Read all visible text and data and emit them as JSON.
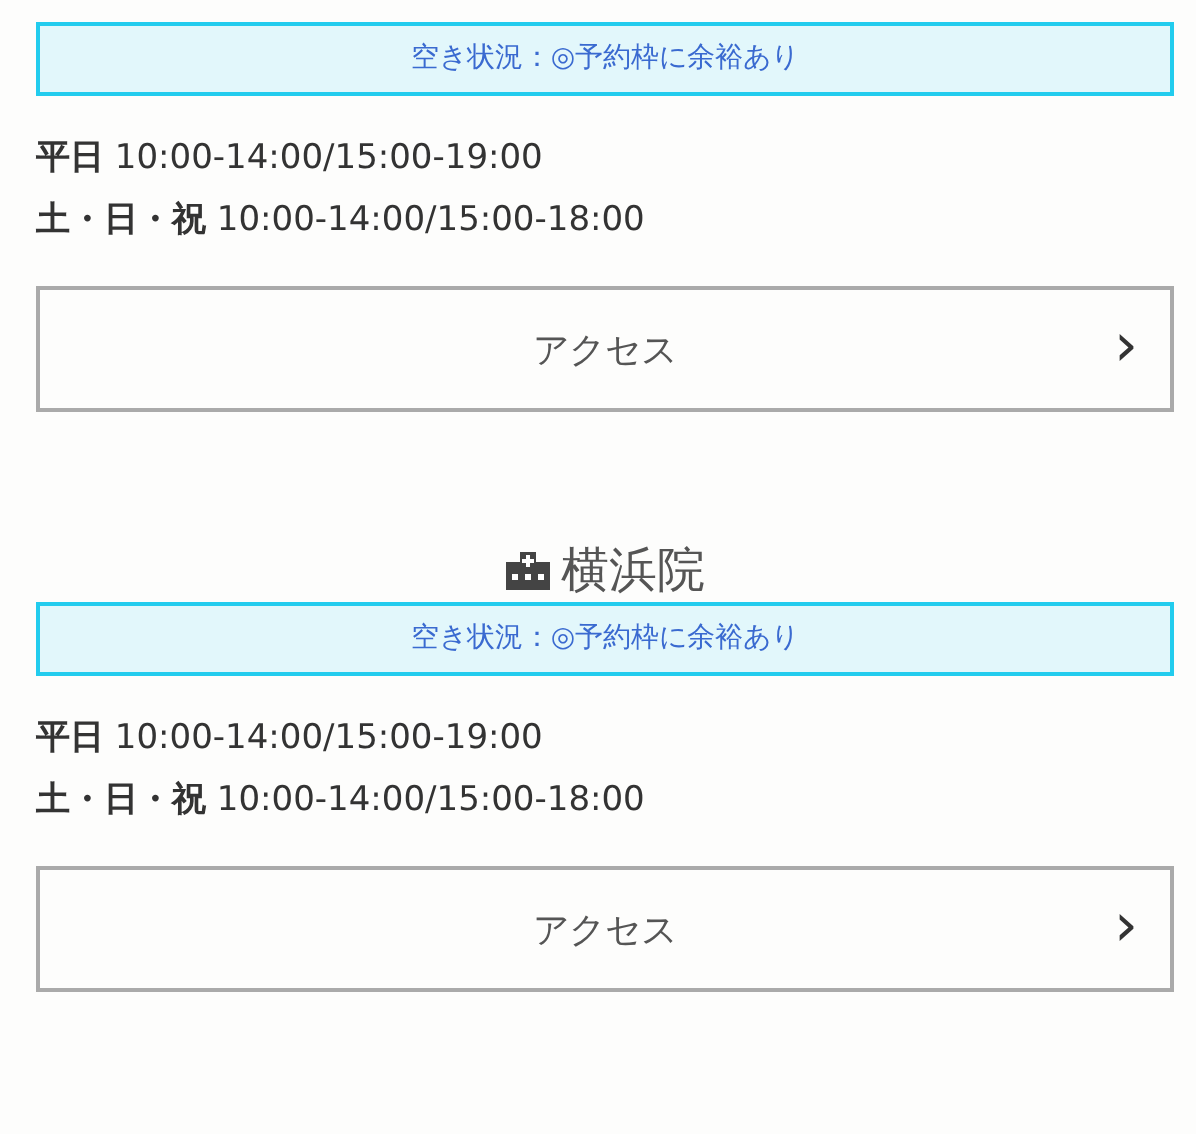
{
  "clinics": [
    {
      "status": "空き状況：◎予約枠に余裕あり",
      "hours": [
        {
          "day": "平日",
          "time": "10:00-14:00/15:00-19:00"
        },
        {
          "day": "土・日・祝",
          "time": "10:00-14:00/15:00-18:00"
        }
      ],
      "button": {
        "label": "アクセス",
        "chevron": "›"
      }
    },
    {
      "name": "横浜院",
      "status": "空き状況：◎予約枠に余裕あり",
      "hours": [
        {
          "day": "平日",
          "time": "10:00-14:00/15:00-19:00"
        },
        {
          "day": "土・日・祝",
          "time": "10:00-14:00/15:00-18:00"
        }
      ],
      "button": {
        "label": "アクセス",
        "chevron": "›"
      }
    }
  ]
}
